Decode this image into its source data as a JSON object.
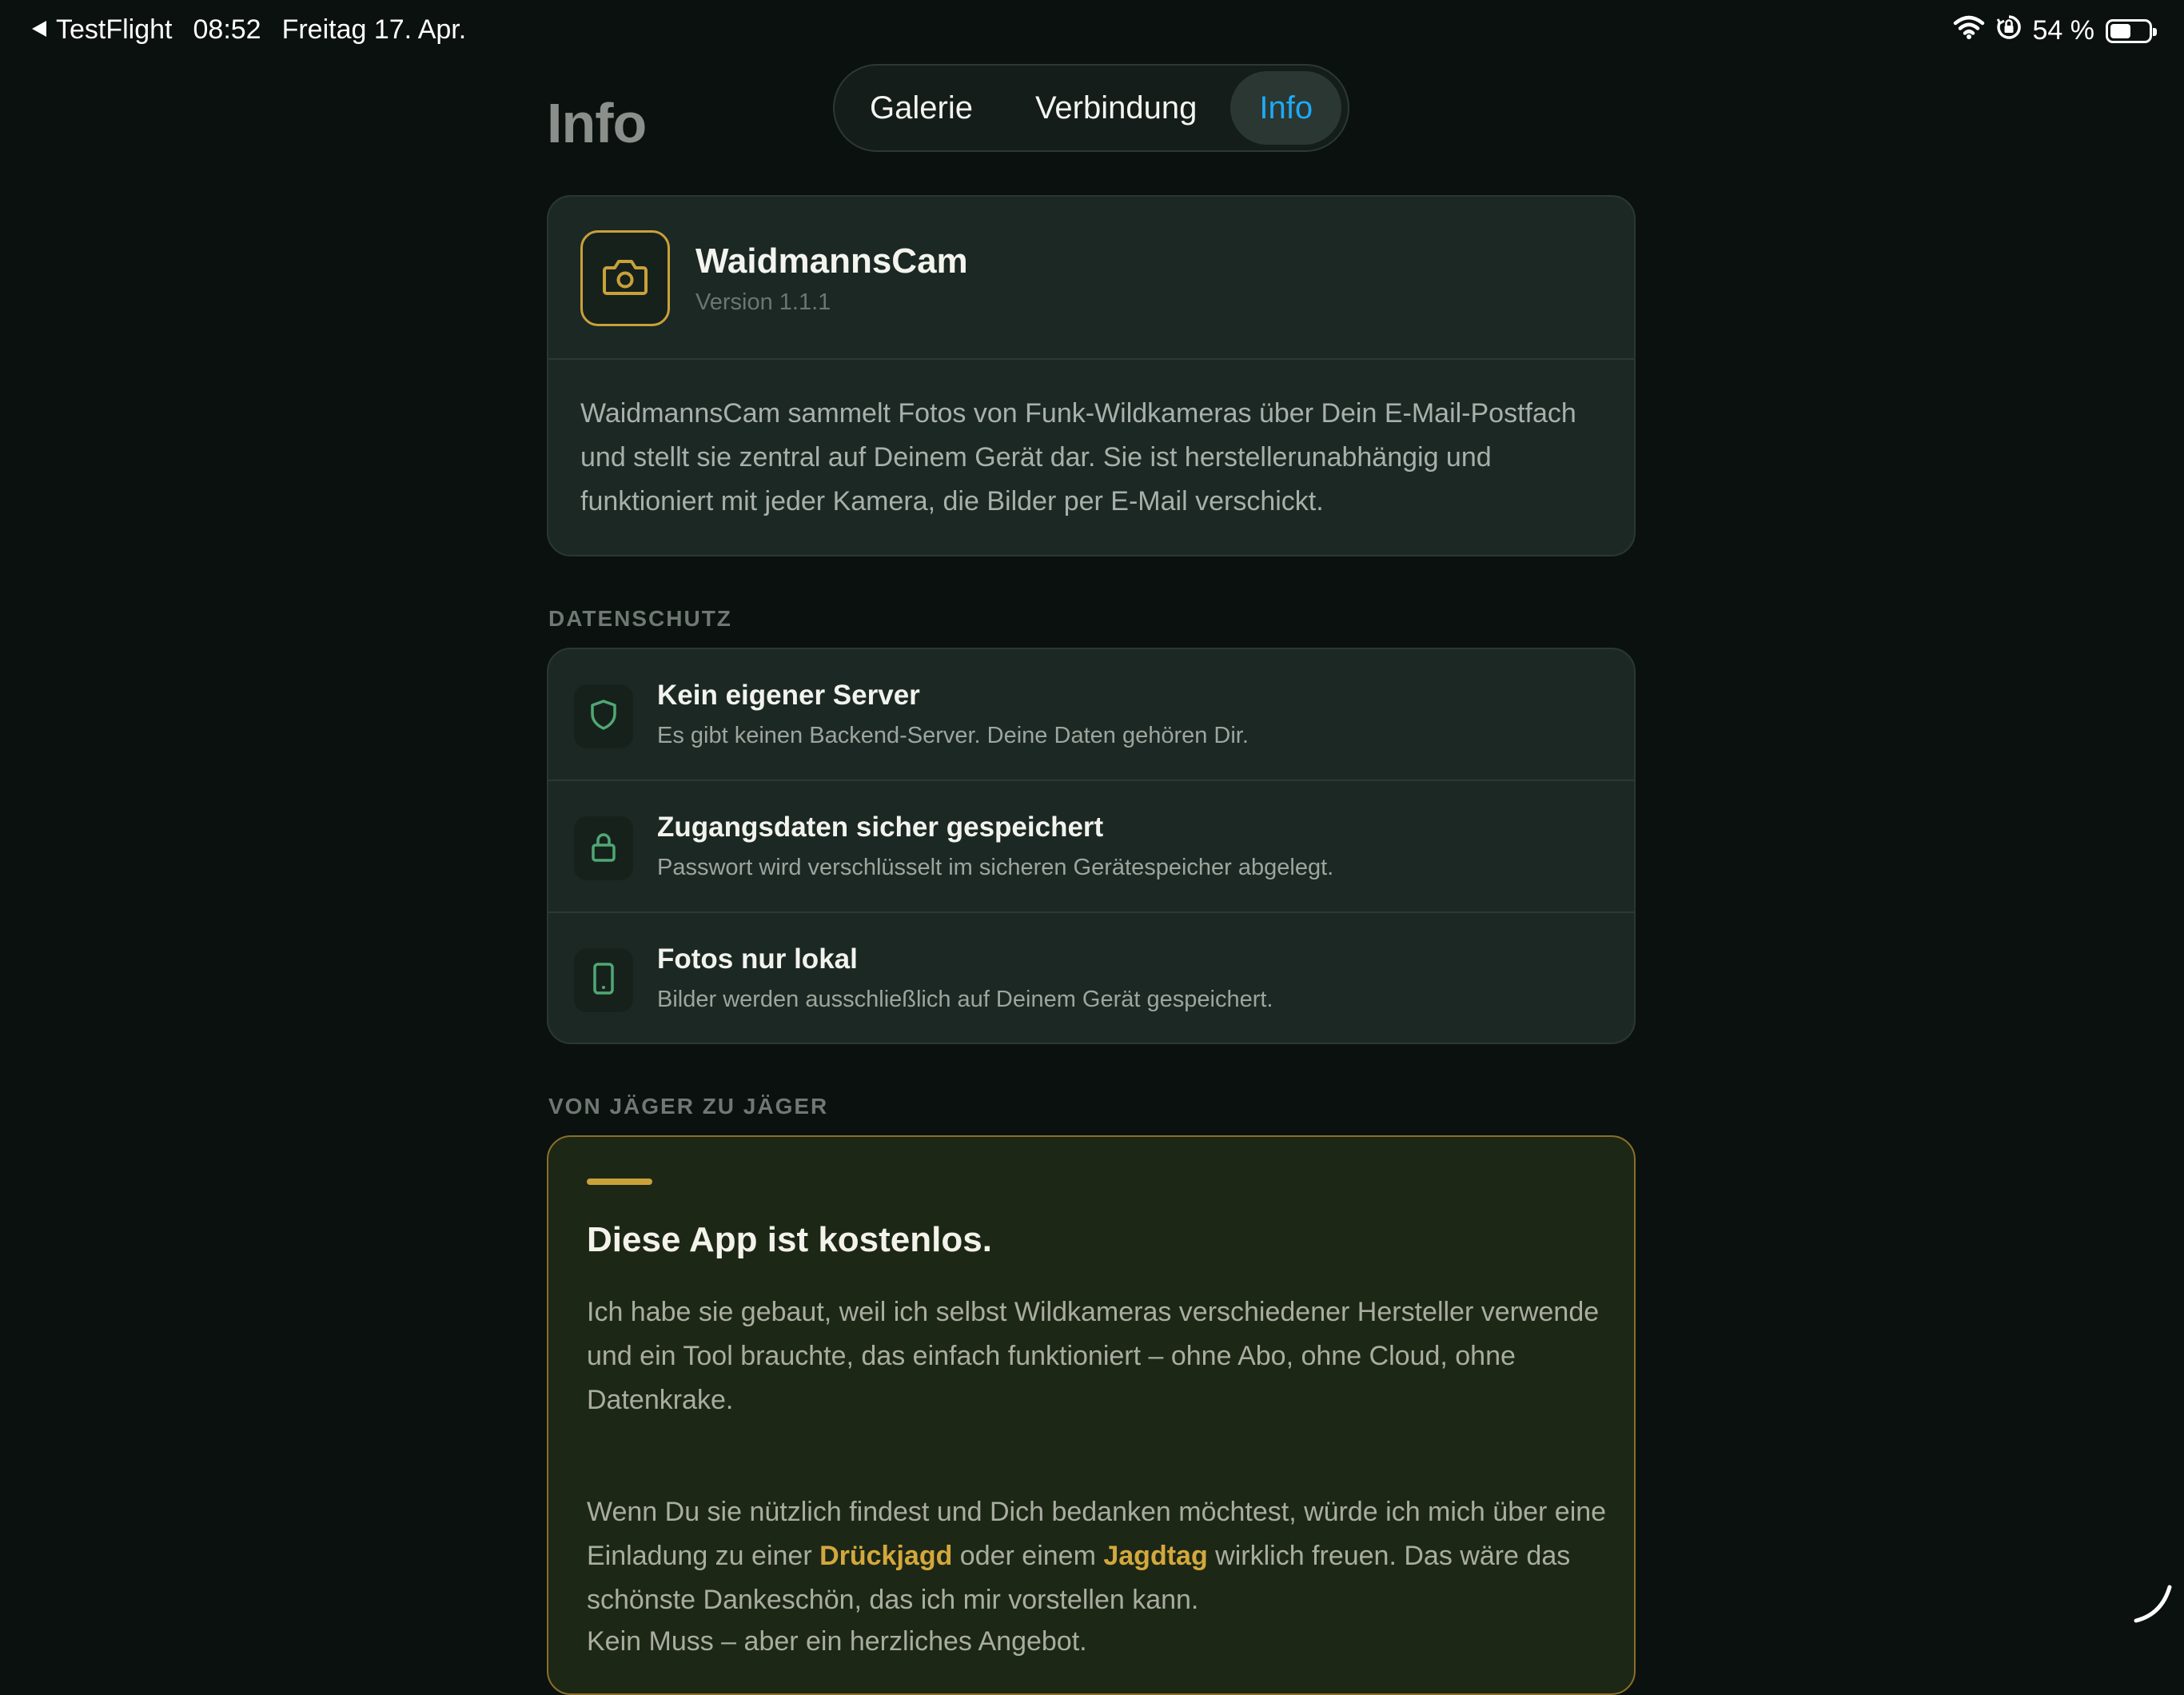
{
  "status_bar": {
    "back_app": "TestFlight",
    "time": "08:52",
    "date": "Freitag 17. Apr.",
    "battery_percent": "54 %",
    "battery_level": 0.54
  },
  "header": {
    "title": "Info",
    "tabs": [
      {
        "label": "Galerie",
        "active": false
      },
      {
        "label": "Verbindung",
        "active": false
      },
      {
        "label": "Info",
        "active": true
      }
    ]
  },
  "app_info": {
    "icon": "camera-icon",
    "name": "WaidmannsCam",
    "version": "Version 1.1.1",
    "description": "WaidmannsCam sammelt Fotos von Funk-Wildkameras über Dein E-Mail-Postfach und stellt sie zentral auf Deinem Gerät dar. Sie ist herstellerunabhängig und funktioniert mit jeder Kamera, die Bilder per E-Mail verschickt."
  },
  "privacy": {
    "section_label": "DATENSCHUTZ",
    "items": [
      {
        "icon": "shield-icon",
        "title": "Kein eigener Server",
        "subtitle": "Es gibt keinen Backend-Server. Deine Daten gehören Dir."
      },
      {
        "icon": "lock-icon",
        "title": "Zugangsdaten sicher gespeichert",
        "subtitle": "Passwort wird verschlüsselt im sicheren Gerätespeicher abgelegt."
      },
      {
        "icon": "phone-icon",
        "title": "Fotos nur lokal",
        "subtitle": "Bilder werden ausschließlich auf Deinem Gerät gespeichert."
      }
    ]
  },
  "hunter": {
    "section_label": "VON JÄGER ZU JÄGER",
    "title": "Diese App ist kostenlos.",
    "paragraph1": "Ich habe sie gebaut, weil ich selbst Wildkameras verschiedener Hersteller verwende und ein Tool brauchte, das einfach funktioniert – ohne Abo, ohne Cloud, ohne Datenkrake.",
    "paragraph2_part1": "Wenn Du sie nützlich findest und Dich bedanken möchtest, würde ich mich über eine Einladung zu einer ",
    "highlight1": "Drückjagd",
    "paragraph2_part2": " oder einem ",
    "highlight2": "Jagdtag",
    "paragraph2_part3": " wirklich freuen. Das wäre das schönste Dankeschön, das ich mir vorstellen kann.",
    "paragraph3": "Kein Muss – aber ein herzliches Angebot."
  },
  "colors": {
    "background": "#0a110e",
    "card": "#1c2823",
    "accent_gold": "#c9a13a",
    "active_tab": "#1fa9f5",
    "icon_green": "#4fa874"
  }
}
